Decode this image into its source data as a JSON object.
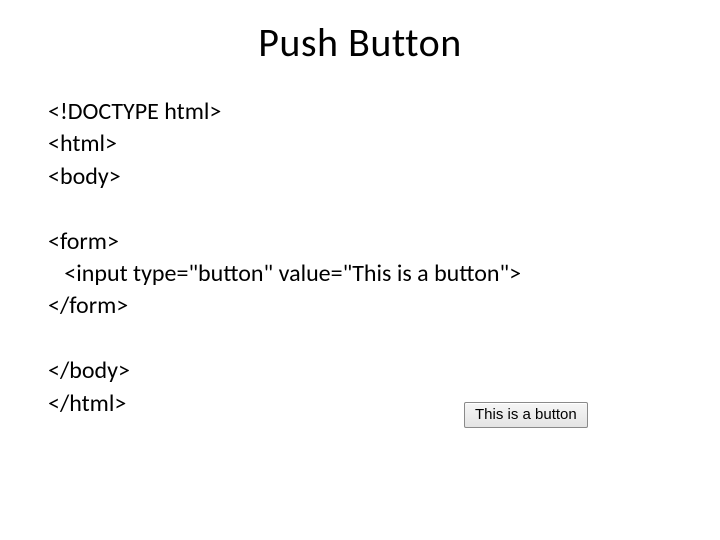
{
  "title": "Push Button",
  "code": {
    "line1": "<!DOCTYPE html>",
    "line2": "<html>",
    "line3": "<body>",
    "line4": "<form>",
    "line5": "   <input type=\"button\" value=\"This is a button\">",
    "line6": "</form>",
    "line7": "</body>",
    "line8": "</html>"
  },
  "button_label": "This is a button"
}
